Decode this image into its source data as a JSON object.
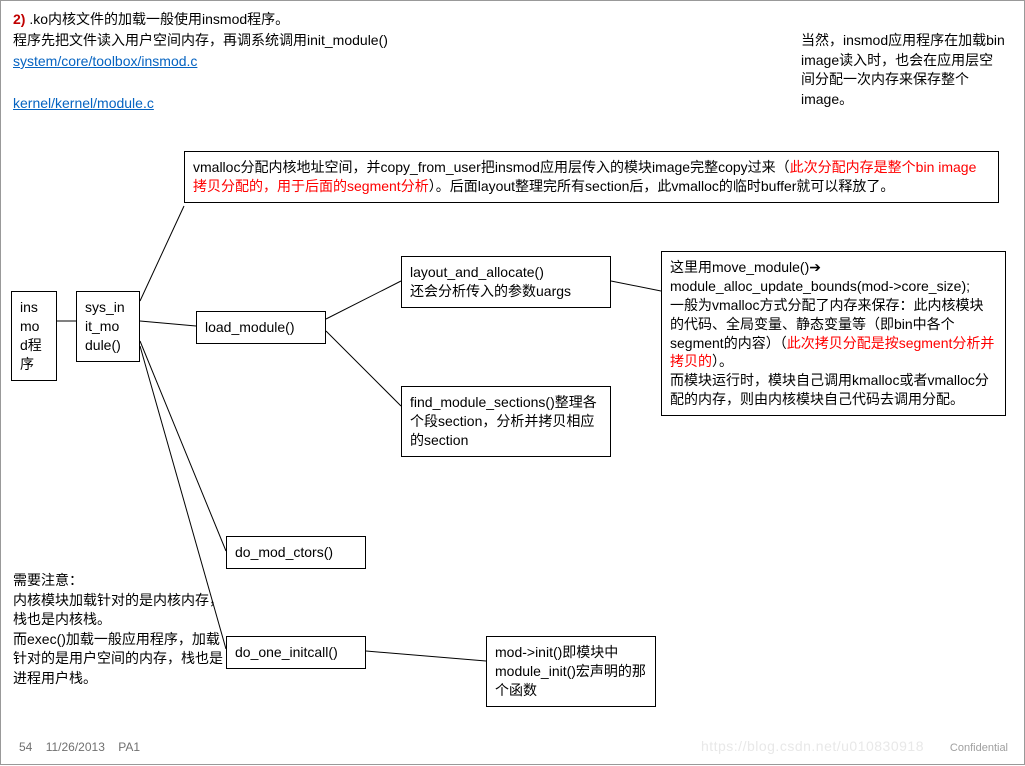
{
  "header": {
    "num": "2)",
    "line1_rest": " .ko内核文件的加载一般使用insmod程序。",
    "line2": "程序先把文件读入用户空间内存，再调系统调用init_module()",
    "link1": "system/core/toolbox/insmod.c",
    "link2": "kernel/kernel/module.c"
  },
  "side_note": "当然，insmod应用程序在加载bin image读入时，也会在应用层空间分配一次内存来保存整个image。",
  "boxes": {
    "insmod": "ins\nmo\nd程\n序",
    "sysinit": "sys_in\nit_mo\ndule()",
    "vmalloc_pre": "vmalloc分配内核地址空间，并copy_from_user把insmod应用层传入的模块image完整copy过来（",
    "vmalloc_red": "此次分配内存是整个bin image拷贝分配的，用于后面的segment分析",
    "vmalloc_post": "）。后面layout整理完所有section后，此vmalloc的临时buffer就可以释放了。",
    "load_module": "load_module()",
    "layout_alloc": "layout_and_allocate()\n还会分析传入的参数uargs",
    "find_sections": "find_module_sections()整理各个段section，分析并拷贝相应的section",
    "move_pre": "这里用move_module()",
    "move_arrow": "➔",
    "move_line2": "module_alloc_update_bounds(mod->core_size);",
    "move_mid": "一般为vmalloc方式分配了内存来保存：此内核模块的代码、全局变量、静态变量等（即bin中各个segment的内容）（",
    "move_red": "此次拷贝分配是按segment分析并拷贝的",
    "move_post": "）。\n而模块运行时，模块自己调用kmalloc或者vmalloc分配的内存，则由内核模块自己代码去调用分配。",
    "do_ctors": "do_mod_ctors()",
    "do_initcall": "do_one_initcall()",
    "mod_init": "mod->init()即模块中module_init()宏声明的那个函数"
  },
  "note2": "需要注意：\n内核模块加载针对的是内核内存，栈也是内核栈。\n而exec()加载一般应用程序，加载针对的是用户空间的内存，栈也是进程用户栈。",
  "footer": {
    "page": "54",
    "date": "11/26/2013",
    "tag": "PA1"
  },
  "confidential": "Confidential",
  "watermark": "https://blog.csdn.net/u010830918"
}
